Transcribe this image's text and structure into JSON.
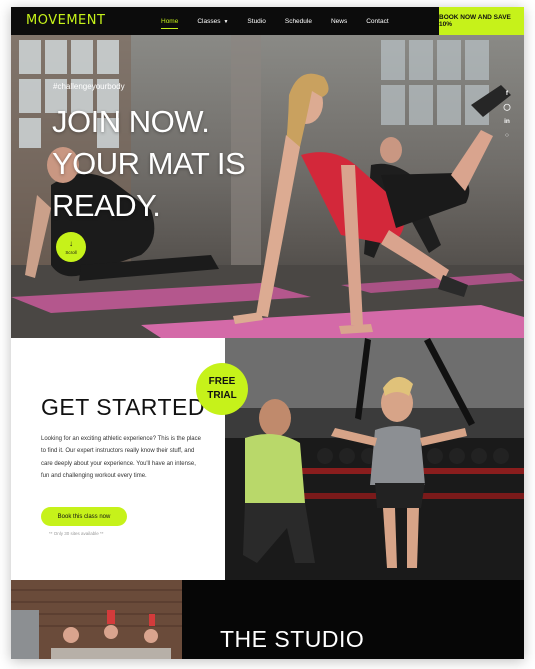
{
  "brand": {
    "logo": "MOVEMENT",
    "accent": "#c6f21a",
    "dark": "#0c0c0c"
  },
  "nav": {
    "items": [
      {
        "label": "Home",
        "active": true
      },
      {
        "label": "Classes",
        "dropdown": true
      },
      {
        "label": "Studio"
      },
      {
        "label": "Schedule"
      },
      {
        "label": "News"
      },
      {
        "label": "Contact"
      }
    ],
    "cta": "BOOK NOW AND SAVE 10%"
  },
  "hero": {
    "hashtag": "#challengeyourbody",
    "title_lines": [
      "JOIN NOW.",
      "YOUR MAT IS",
      "READY."
    ],
    "scroll_label": "Scroll",
    "social_icons": [
      "facebook-icon",
      "instagram-icon",
      "linkedin-icon",
      "pinterest-icon"
    ]
  },
  "get_started": {
    "badge_line1": "FREE",
    "badge_line2": "TRIAL",
    "heading": "GET STARTED",
    "body": "Looking for an exciting athletic experience? This is the place to find it. Our expert instructors really know their stuff, and care deeply about your experience. You'll have an intense, fun and challenging workout every time.",
    "button": "Book this class now",
    "note": "** Only 30 sites available **"
  },
  "studio": {
    "heading": "THE STUDIO"
  }
}
